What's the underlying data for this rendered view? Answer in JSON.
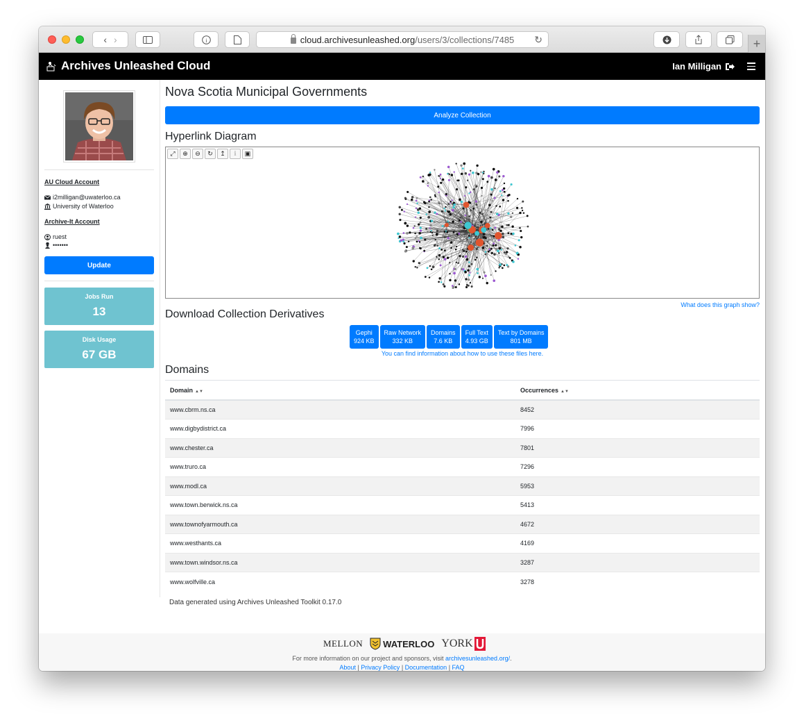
{
  "browser": {
    "url_host": "cloud.archivesunleashed.org",
    "url_path": "/users/3/collections/7485"
  },
  "navbar": {
    "brand": "Archives Unleashed Cloud",
    "user": "Ian Milligan"
  },
  "sidebar": {
    "au_heading": "AU Cloud Account",
    "email": "i2milligan@uwaterloo.ca",
    "institution": "University of Waterloo",
    "ait_heading": "Archive-It Account",
    "ait_user": "ruest",
    "ait_password": "•••••••",
    "update_label": "Update",
    "jobs_label": "Jobs Run",
    "jobs_value": "13",
    "disk_label": "Disk Usage",
    "disk_value": "67 GB"
  },
  "main": {
    "title": "Nova Scotia Municipal Governments",
    "analyze_label": "Analyze Collection",
    "hyperlink_title": "Hyperlink Diagram",
    "graph_help": "What does this graph show?",
    "derivatives_title": "Download Collection Derivatives",
    "derivatives": [
      {
        "name": "Gephi",
        "size": "924 KB"
      },
      {
        "name": "Raw Network",
        "size": "332 KB"
      },
      {
        "name": "Domains",
        "size": "7.6 KB"
      },
      {
        "name": "Full Text",
        "size": "4.93 GB"
      },
      {
        "name": "Text by Domains",
        "size": "801 MB"
      }
    ],
    "derivatives_help": "You can find information about how to use these files here.",
    "domains_title": "Domains",
    "col_domain": "Domain",
    "col_occ": "Occurrences",
    "rows": [
      {
        "domain": "www.cbrm.ns.ca",
        "occ": "8452"
      },
      {
        "domain": "www.digbydistrict.ca",
        "occ": "7996"
      },
      {
        "domain": "www.chester.ca",
        "occ": "7801"
      },
      {
        "domain": "www.truro.ca",
        "occ": "7296"
      },
      {
        "domain": "www.modl.ca",
        "occ": "5953"
      },
      {
        "domain": "www.town.berwick.ns.ca",
        "occ": "5413"
      },
      {
        "domain": "www.townofyarmouth.ca",
        "occ": "4672"
      },
      {
        "domain": "www.westhants.ca",
        "occ": "4169"
      },
      {
        "domain": "www.town.windsor.ns.ca",
        "occ": "3287"
      },
      {
        "domain": "www.wolfville.ca",
        "occ": "3278"
      }
    ],
    "toolkit_note": "Data generated using Archives Unleashed Toolkit 0.17.0"
  },
  "footer": {
    "mellon": "MELLON",
    "waterloo": "WATERLOO",
    "york": "YORK",
    "info_prefix": "For more information on our project and sponsors, visit ",
    "info_link": "archivesunleashed.org/",
    "info_suffix": ".",
    "links": [
      "About",
      "Privacy Policy",
      "Documentation",
      "FAQ"
    ]
  },
  "colors": {
    "primary": "#007bff",
    "stat": "#6fc3d0",
    "navbar": "#000000",
    "node_orange": "#e0552e",
    "node_cyan": "#3fc7d1",
    "node_purple": "#9b59d0",
    "node_green": "#2ecc71"
  }
}
